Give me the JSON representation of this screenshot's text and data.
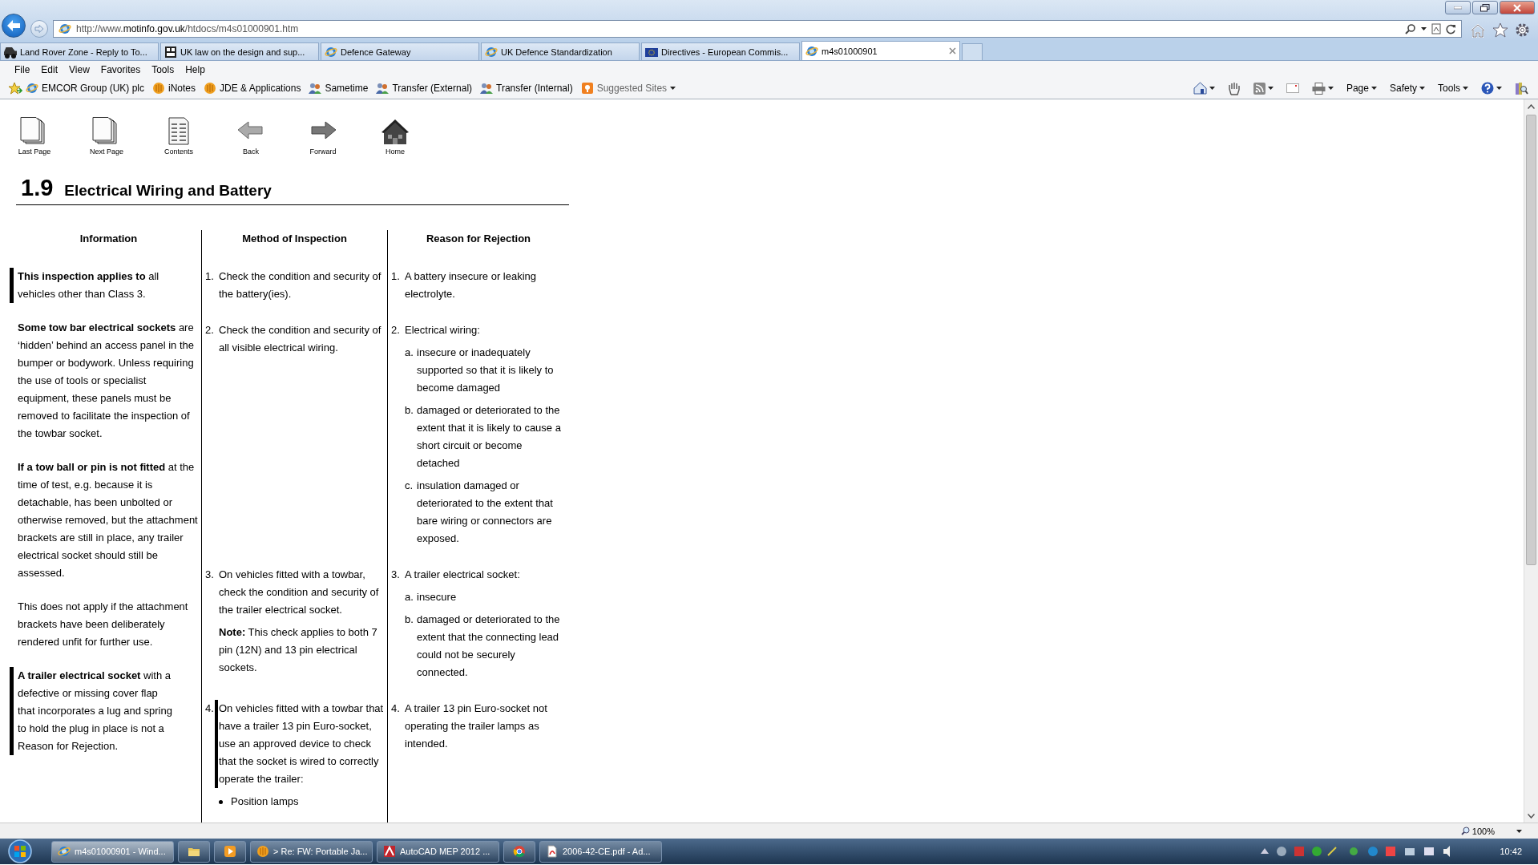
{
  "address_bar": {
    "url": "http://www.**motinfo.gov.uk**/htdocs/m4s01000901.htm"
  },
  "tabs": [
    {
      "label": "Land Rover Zone - Reply to To...",
      "kind": "car",
      "selected": false
    },
    {
      "label": "UK law on the design and sup...",
      "kind": "logo",
      "selected": false
    },
    {
      "label": "Defence Gateway",
      "kind": "ie",
      "selected": false
    },
    {
      "label": "UK Defence Standardization",
      "kind": "ie",
      "selected": false
    },
    {
      "label": "Directives - European Commis...",
      "kind": "flag",
      "selected": false
    },
    {
      "label": "m4s01000901",
      "kind": "ie",
      "selected": true
    }
  ],
  "menu": [
    "File",
    "Edit",
    "View",
    "Favorites",
    "Tools",
    "Help"
  ],
  "favorites": [
    {
      "label": "EMCOR Group (UK) plc",
      "kind": "ie"
    },
    {
      "label": "iNotes",
      "kind": "lotus"
    },
    {
      "label": "JDE & Applications",
      "kind": "lotus"
    },
    {
      "label": "Sametime",
      "kind": "people"
    },
    {
      "label": "Transfer (External)",
      "kind": "people"
    },
    {
      "label": "Transfer (Internal)",
      "kind": "people"
    },
    {
      "label": "Suggested Sites",
      "kind": "suggested"
    }
  ],
  "command_bar": [
    "Page",
    "Safety",
    "Tools"
  ],
  "nav": [
    {
      "label": "Last Page",
      "kind": "pages"
    },
    {
      "label": "Next Page",
      "kind": "pages"
    },
    {
      "label": "Contents",
      "kind": "contents"
    },
    {
      "label": "Back",
      "kind": "back"
    },
    {
      "label": "Forward",
      "kind": "forward"
    },
    {
      "label": "Home",
      "kind": "home"
    }
  ],
  "section": {
    "number": "1.9",
    "title": "Electrical Wiring and Battery"
  },
  "table": {
    "columns": [
      "Information",
      "Method of Inspection",
      "Reason for Rejection"
    ],
    "information": [
      {
        "text": "**This inspection applies to** all vehicles other than Class 3.",
        "changed": true
      },
      {
        "text": "**Some tow bar electrical sockets** are ‘hidden’ behind an access panel in the bumper or bodywork.  Unless requiring the use of tools or specialist equipment, these panels must be removed to facilitate the inspection of the towbar socket.",
        "changed": false
      },
      {
        "text": "**If a tow ball or pin is not fitted** at the time of test, e.g. because it is detachable, has been unbolted or otherwise removed, but the attachment brackets are still in place, any trailer electrical socket should still be assessed.",
        "changed": false
      },
      {
        "text": "This does not apply if the attachment brackets have been deliberately rendered unfit for further use.",
        "changed": false
      },
      {
        "text": "**A trailer electrical socket** with a defective or missing cover flap that incorporates a lug and spring to hold the plug in place is not a Reason for Rejection.",
        "changed": true
      }
    ],
    "rows": [
      {
        "method": {
          "number": "1.",
          "text": "Check the condition and security of the battery(ies).",
          "changed": false
        },
        "reason": {
          "number": "1.",
          "text": "A battery insecure or leaking electrolyte."
        }
      },
      {
        "method": {
          "number": "2.",
          "text": "Check the condition and security of all visible electrical wiring.",
          "changed": false
        },
        "reason": {
          "number": "2.",
          "text": "Electrical wiring:",
          "items": [
            {
              "letter": "a.",
              "text": "insecure or inadequately supported so that it is likely to become damaged"
            },
            {
              "letter": "b.",
              "text": "damaged or deteriorated to the extent that it is likely to cause a short circuit or become detached"
            },
            {
              "letter": "c.",
              "text": "insulation damaged or deteriorated to the extent that bare wiring or connectors are exposed."
            }
          ]
        }
      },
      {
        "method": {
          "number": "3.",
          "text": "On vehicles fitted with a towbar, check the condition and security of the trailer electrical socket.",
          "note": "**Note:** This check applies to both 7 pin (12N) and 13 pin electrical sockets.",
          "changed": false
        },
        "reason": {
          "number": "3.",
          "text": "A trailer electrical socket:",
          "items": [
            {
              "letter": "a.",
              "text": "insecure"
            },
            {
              "letter": "b.",
              "text": "damaged or deteriorated to the extent that the connecting lead could not be securely connected."
            }
          ]
        }
      },
      {
        "method": {
          "number": "4.",
          "text": "On vehicles fitted with a towbar that have a trailer 13 pin Euro-socket, use an approved device to check that the socket is wired to correctly operate the trailer:",
          "bullets": [
            "Position lamps"
          ],
          "changed": true
        },
        "reason": {
          "number": "4.",
          "text": "A trailer 13 pin Euro-socket not operating the trailer lamps as intended."
        }
      }
    ]
  },
  "status_bar": {
    "zoom": "100%"
  },
  "taskbar": {
    "items": [
      {
        "label": "m4s01000901 - Wind...",
        "kind": "ie",
        "selected": true
      },
      {
        "kind": "folder",
        "selected": false
      },
      {
        "kind": "media",
        "selected": false
      },
      {
        "label": "> Re: FW: Portable Ja...",
        "kind": "lotus",
        "selected": false
      },
      {
        "label": "AutoCAD MEP 2012 ...",
        "kind": "autocad",
        "selected": false
      },
      {
        "kind": "chrome",
        "selected": false
      },
      {
        "label": "2006-42-CE.pdf - Ad...",
        "kind": "pdf",
        "selected": false
      }
    ],
    "clock": "10:42"
  }
}
